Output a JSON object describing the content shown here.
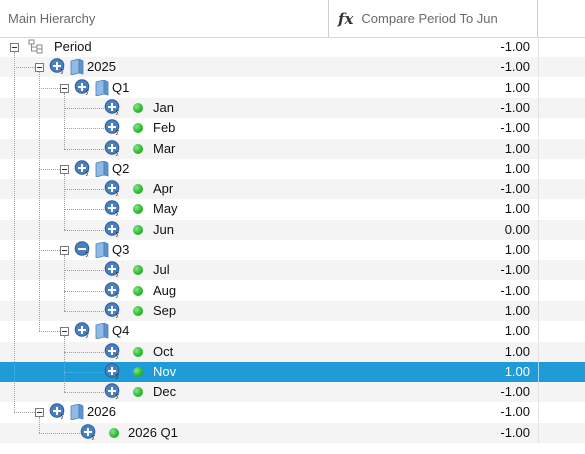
{
  "header": {
    "col1": "Main Hierarchy",
    "col2_icon": "fx-icon",
    "col2": "Compare Period To Jun"
  },
  "colors": {
    "selection": "#1f9bd8",
    "status_green": "#2dbd2d",
    "folder_blue": "#6fa6d6",
    "alt_row": "#f4f4f4"
  },
  "rows": [
    {
      "label": "Period",
      "value": "-1.00",
      "type": "root"
    },
    {
      "label": "2025",
      "value": "-1.00",
      "type": "year",
      "state": "expanded"
    },
    {
      "label": "Q1",
      "value": "1.00",
      "type": "quarter",
      "state": "expanded"
    },
    {
      "label": "Jan",
      "value": "-1.00",
      "type": "month"
    },
    {
      "label": "Feb",
      "value": "-1.00",
      "type": "month"
    },
    {
      "label": "Mar",
      "value": "1.00",
      "type": "month"
    },
    {
      "label": "Q2",
      "value": "1.00",
      "type": "quarter",
      "state": "expanded"
    },
    {
      "label": "Apr",
      "value": "-1.00",
      "type": "month"
    },
    {
      "label": "May",
      "value": "1.00",
      "type": "month"
    },
    {
      "label": "Jun",
      "value": "0.00",
      "type": "month"
    },
    {
      "label": "Q3",
      "value": "1.00",
      "type": "quarter",
      "state": "expanded",
      "icon": "minus"
    },
    {
      "label": "Jul",
      "value": "-1.00",
      "type": "month"
    },
    {
      "label": "Aug",
      "value": "-1.00",
      "type": "month"
    },
    {
      "label": "Sep",
      "value": "1.00",
      "type": "month"
    },
    {
      "label": "Q4",
      "value": "1.00",
      "type": "quarter",
      "state": "expanded"
    },
    {
      "label": "Oct",
      "value": "1.00",
      "type": "month"
    },
    {
      "label": "Nov",
      "value": "1.00",
      "type": "month",
      "selected": true
    },
    {
      "label": "Dec",
      "value": "-1.00",
      "type": "month"
    },
    {
      "label": "2026",
      "value": "-1.00",
      "type": "year",
      "state": "expanded"
    },
    {
      "label": "2026 Q1",
      "value": "-1.00",
      "type": "quarter-leaf"
    }
  ]
}
